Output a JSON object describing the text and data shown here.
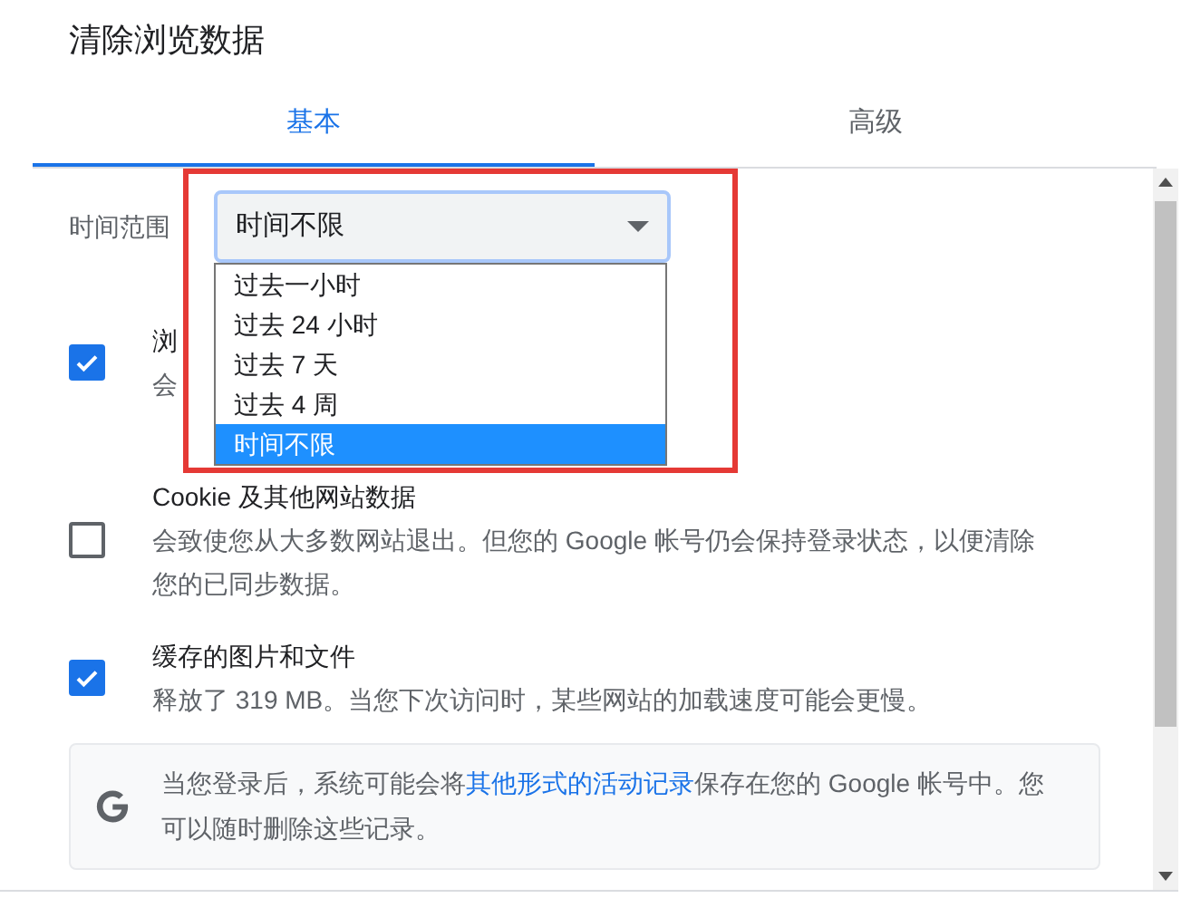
{
  "dialog": {
    "title": "清除浏览数据"
  },
  "tabs": [
    {
      "label": "基本",
      "selected": true
    },
    {
      "label": "高级",
      "selected": false
    }
  ],
  "time_range": {
    "label": "时间范围",
    "value": "时间不限",
    "expanded": true,
    "options": [
      {
        "label": "过去一小时",
        "selected": false
      },
      {
        "label": "过去 24 小时",
        "selected": false
      },
      {
        "label": "过去 7 天",
        "selected": false
      },
      {
        "label": "过去 4 周",
        "selected": false
      },
      {
        "label": "时间不限",
        "selected": true
      }
    ]
  },
  "items": [
    {
      "title": "浏",
      "description": "会",
      "checked": true
    },
    {
      "title": "Cookie 及其他网站数据",
      "description": "会致使您从大多数网站退出。但您的 Google 帐号仍会保持登录状态，以便清除您的已同步数据。",
      "checked": false
    },
    {
      "title": "缓存的图片和文件",
      "description": "释放了 319 MB。当您下次访问时，某些网站的加载速度可能会更慢。",
      "checked": true
    }
  ],
  "notice": {
    "text_before": "当您登录后，系统可能会将",
    "link": "其他形式的活动记录",
    "text_after": "保存在您的 Google 帐号中。您可以随时删除这些记录。"
  }
}
